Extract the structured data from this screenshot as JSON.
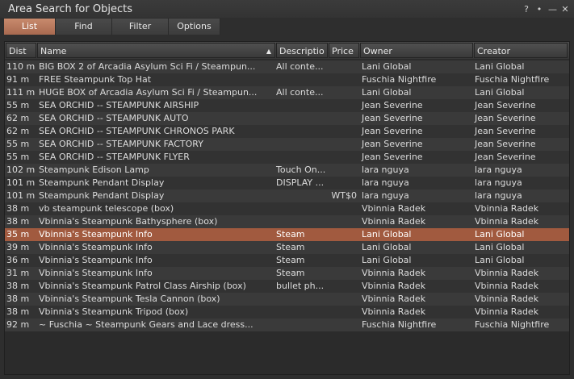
{
  "window": {
    "title": "Area Search for Objects",
    "controls": [
      "?",
      "•",
      "—",
      "✕"
    ]
  },
  "tabs": [
    {
      "label": "List",
      "active": true
    },
    {
      "label": "Find",
      "active": false
    },
    {
      "label": "Filter",
      "active": false
    },
    {
      "label": "Options",
      "active": false
    }
  ],
  "columns": {
    "dist": "Dist",
    "name": "Name",
    "desc": "Descriptio",
    "price": "Price",
    "owner": "Owner",
    "creator": "Creator"
  },
  "sort_indicator": "▲",
  "rows": [
    {
      "dist": "110 m",
      "name": "BIG BOX 2 of Arcadia Asylum Sci Fi / Steampun...",
      "desc": "All conte...",
      "price": "",
      "owner": "Lani Global",
      "creator": "Lani Global"
    },
    {
      "dist": "91 m",
      "name": "FREE Steampunk Top Hat",
      "desc": "",
      "price": "",
      "owner": "Fuschia Nightfire",
      "creator": "Fuschia Nightfire"
    },
    {
      "dist": "111 m",
      "name": "HUGE BOX of Arcadia Asylum Sci Fi / Steampun...",
      "desc": "All conte...",
      "price": "",
      "owner": "Lani Global",
      "creator": "Lani Global"
    },
    {
      "dist": "55 m",
      "name": "SEA ORCHID -- STEAMPUNK AIRSHIP",
      "desc": "",
      "price": "",
      "owner": "Jean Severine",
      "creator": "Jean Severine"
    },
    {
      "dist": "62 m",
      "name": "SEA ORCHID -- STEAMPUNK AUTO",
      "desc": "",
      "price": "",
      "owner": "Jean Severine",
      "creator": "Jean Severine"
    },
    {
      "dist": "62 m",
      "name": "SEA ORCHID -- STEAMPUNK CHRONOS PARK",
      "desc": "",
      "price": "",
      "owner": "Jean Severine",
      "creator": "Jean Severine"
    },
    {
      "dist": "55 m",
      "name": "SEA ORCHID -- STEAMPUNK FACTORY",
      "desc": "",
      "price": "",
      "owner": "Jean Severine",
      "creator": "Jean Severine"
    },
    {
      "dist": "55 m",
      "name": "SEA ORCHID -- STEAMPUNK FLYER",
      "desc": "",
      "price": "",
      "owner": "Jean Severine",
      "creator": "Jean Severine"
    },
    {
      "dist": "102 m",
      "name": "Steampunk Edison Lamp",
      "desc": "Touch On...",
      "price": "",
      "owner": "lara nguya",
      "creator": "lara nguya"
    },
    {
      "dist": "101 m",
      "name": "Steampunk Pendant Display",
      "desc": "DISPLAY ...",
      "price": "",
      "owner": "lara nguya",
      "creator": "lara nguya"
    },
    {
      "dist": "101 m",
      "name": "Steampunk Pendant Display",
      "desc": "",
      "price": "WT$0",
      "owner": "lara nguya",
      "creator": "lara nguya"
    },
    {
      "dist": "38 m",
      "name": "vb steampunk telescope (box)",
      "desc": "",
      "price": "",
      "owner": "Vbinnia Radek",
      "creator": "Vbinnia Radek"
    },
    {
      "dist": "38 m",
      "name": "Vbinnia's Steampunk Bathysphere (box)",
      "desc": "",
      "price": "",
      "owner": "Vbinnia Radek",
      "creator": "Vbinnia Radek"
    },
    {
      "dist": "35 m",
      "name": "Vbinnia's Steampunk Info",
      "desc": "Steam",
      "price": "",
      "owner": "Lani Global",
      "creator": "Lani Global",
      "selected": true
    },
    {
      "dist": "39 m",
      "name": "Vbinnia's Steampunk Info",
      "desc": "Steam",
      "price": "",
      "owner": "Lani Global",
      "creator": "Lani Global"
    },
    {
      "dist": "36 m",
      "name": "Vbinnia's Steampunk Info",
      "desc": "Steam",
      "price": "",
      "owner": "Lani Global",
      "creator": "Lani Global"
    },
    {
      "dist": "31 m",
      "name": "Vbinnia's Steampunk Info",
      "desc": "Steam",
      "price": "",
      "owner": "Vbinnia Radek",
      "creator": "Vbinnia Radek"
    },
    {
      "dist": "38 m",
      "name": "Vbinnia's Steampunk Patrol Class Airship (box)",
      "desc": "bullet ph...",
      "price": "",
      "owner": "Vbinnia Radek",
      "creator": "Vbinnia Radek"
    },
    {
      "dist": "38 m",
      "name": "Vbinnia's Steampunk Tesla Cannon (box)",
      "desc": "",
      "price": "",
      "owner": "Vbinnia Radek",
      "creator": "Vbinnia Radek"
    },
    {
      "dist": "38 m",
      "name": "Vbinnia's Steampunk Tripod (box)",
      "desc": "",
      "price": "",
      "owner": "Vbinnia Radek",
      "creator": "Vbinnia Radek"
    },
    {
      "dist": "92 m",
      "name": "~ Fuschia ~ Steampunk Gears and Lace dress...",
      "desc": "",
      "price": "",
      "owner": "Fuschia Nightfire",
      "creator": "Fuschia Nightfire"
    }
  ]
}
